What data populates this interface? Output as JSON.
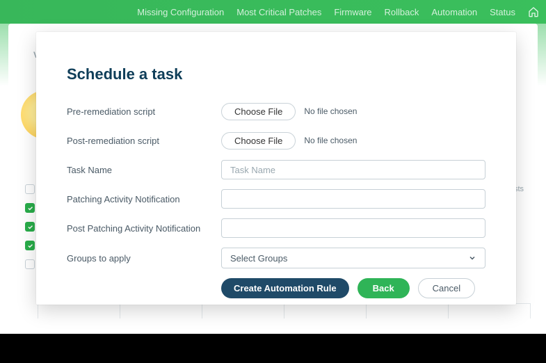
{
  "nav": {
    "items": [
      "Missing Configuration",
      "Most Critical Patches",
      "Firmware",
      "Rollback",
      "Automation",
      "Status"
    ]
  },
  "background": {
    "left_text": "V",
    "right_text": "sts"
  },
  "modal": {
    "title": "Schedule a task",
    "fields": {
      "pre_script": {
        "label": "Pre-remediation script",
        "button": "Choose File",
        "status": "No file chosen"
      },
      "post_script": {
        "label": "Post-remediation script",
        "button": "Choose File",
        "status": "No file chosen"
      },
      "task_name": {
        "label": "Task Name",
        "placeholder": "Task Name",
        "value": ""
      },
      "patch_notif": {
        "label": "Patching Activity Notification",
        "value": ""
      },
      "post_patch_notif": {
        "label": "Post Patching Activity Notification",
        "value": ""
      },
      "groups": {
        "label": "Groups to apply",
        "selected": "Select Groups"
      }
    },
    "buttons": {
      "create": "Create Automation Rule",
      "back": "Back",
      "cancel": "Cancel"
    }
  }
}
